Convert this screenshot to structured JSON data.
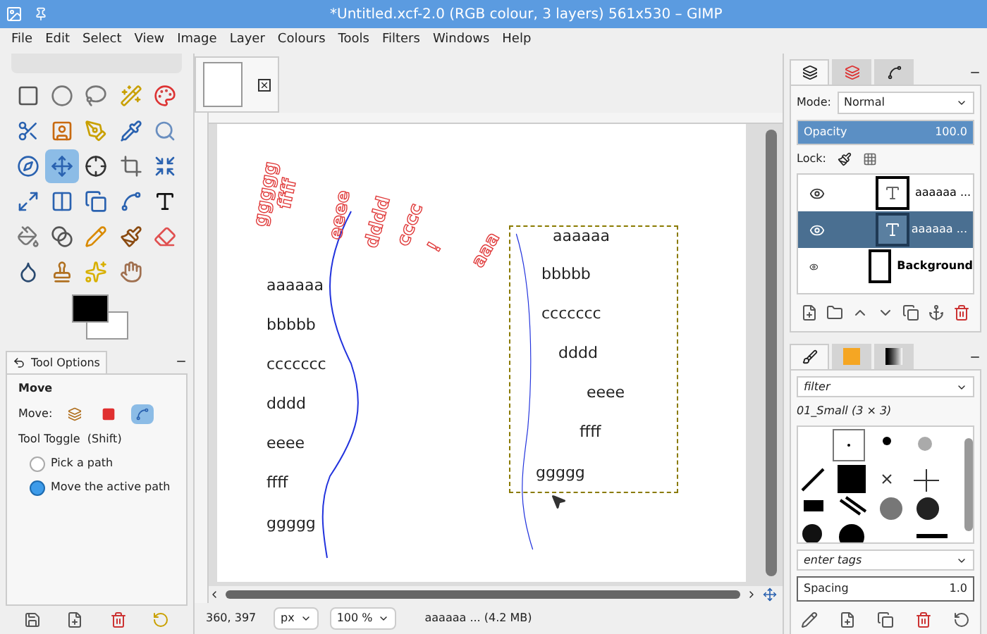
{
  "window": {
    "title": "*Untitled.xcf-2.0 (RGB colour, 3 layers) 561x530 – GIMP"
  },
  "menu": [
    "File",
    "Edit",
    "Select",
    "View",
    "Image",
    "Layer",
    "Colours",
    "Tools",
    "Filters",
    "Windows",
    "Help"
  ],
  "tools": [
    {
      "selected": false
    },
    {
      "selected": false
    },
    {
      "selected": false
    },
    {
      "selected": false
    },
    {
      "selected": false
    },
    {
      "selected": false
    },
    {
      "selected": false
    },
    {
      "selected": false
    },
    {
      "selected": false
    },
    {
      "selected": false
    },
    {
      "selected": false
    },
    {
      "selected": true
    },
    {
      "selected": false
    },
    {
      "selected": false
    },
    {
      "selected": false
    },
    {
      "selected": false
    },
    {
      "selected": false
    },
    {
      "selected": false
    },
    {
      "selected": false
    },
    {
      "selected": false
    },
    {
      "selected": false
    },
    {
      "selected": false
    },
    {
      "selected": false
    },
    {
      "selected": false
    },
    {
      "selected": false
    },
    {
      "selected": false
    },
    {
      "selected": false
    },
    {
      "selected": false
    },
    {
      "selected": false
    }
  ],
  "tool_options": {
    "tab": "Tool Options",
    "tool": "Move",
    "move_label": "Move:",
    "modes": [
      {
        "selected": false
      },
      {
        "selected": false
      },
      {
        "selected": true
      }
    ],
    "toggle_label": "Tool Toggle  (Shift)",
    "radios": [
      {
        "label": "Pick a path",
        "selected": false
      },
      {
        "label": "Move the active path",
        "selected": true
      }
    ]
  },
  "canvas": {
    "outline_texts": [
      "ggggg",
      "ffff",
      "eeee",
      "dddd",
      "cccc",
      "!",
      "aaa"
    ],
    "left_texts": [
      "aaaaaa",
      "bbbbb",
      "ccccccc",
      "dddd",
      "eeee",
      "ffff",
      "ggggg"
    ],
    "right_texts": [
      "aaaaaa",
      "bbbbb",
      "ccccccc",
      "dddd",
      "eeee",
      "ffff",
      "ggggg"
    ]
  },
  "status_bar": {
    "coords": "360, 397",
    "unit": "px",
    "zoom": "100 %",
    "info": "aaaaaa ... (4.2 MB)"
  },
  "layers_panel": {
    "mode_label": "Mode:",
    "mode": "Normal",
    "opacity_label": "Opacity",
    "opacity_value": "100.0",
    "level": 1.0,
    "lock_label": "Lock:",
    "layers": [
      {
        "name": "aaaaaa ...",
        "kind": "text",
        "selected": false
      },
      {
        "name": "aaaaaa ...",
        "kind": "text",
        "selected": true
      },
      {
        "name": "Background",
        "kind": "image",
        "selected": false
      }
    ]
  },
  "brushes_panel": {
    "filter": "filter",
    "brush_name": "01_Small (3 × 3)",
    "tags_placeholder": "enter tags",
    "spacing_label": "Spacing",
    "spacing_value": "1.0"
  }
}
